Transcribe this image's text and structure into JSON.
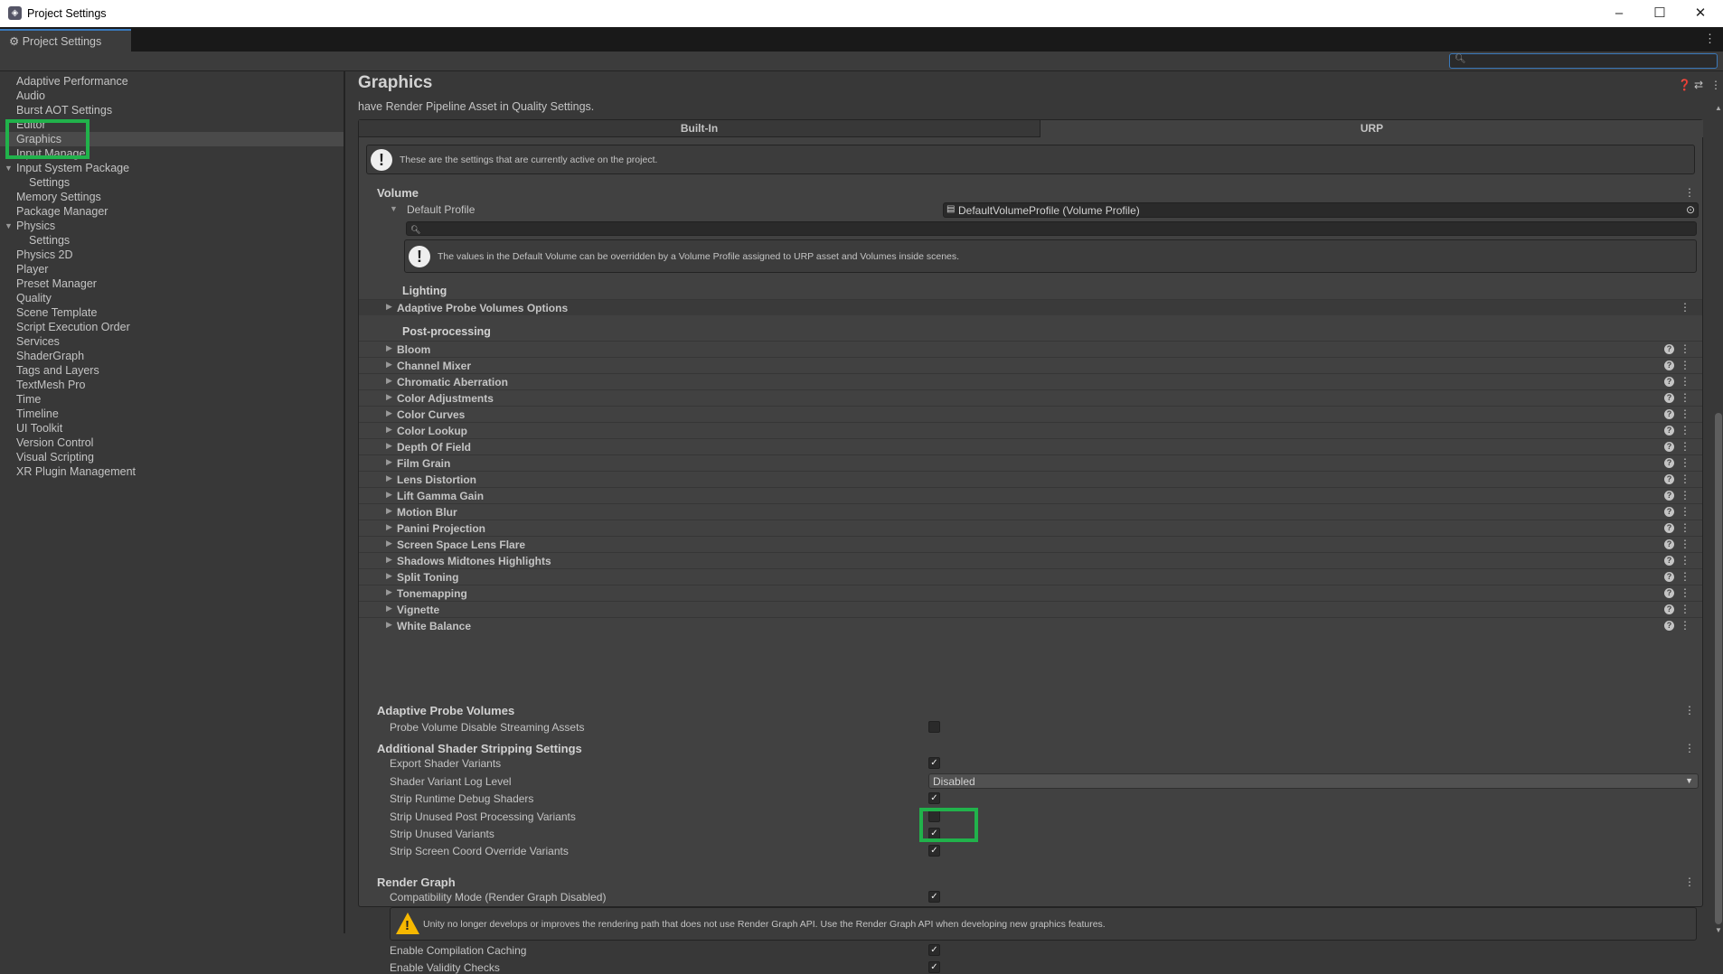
{
  "window": {
    "title": "Project Settings",
    "controls": [
      "minimize",
      "maximize",
      "close"
    ]
  },
  "tab": {
    "label": "Project Settings"
  },
  "search": {
    "placeholder": "",
    "value": ""
  },
  "sidebar": {
    "items": [
      {
        "label": "Adaptive Performance"
      },
      {
        "label": "Audio"
      },
      {
        "label": "Burst AOT Settings"
      },
      {
        "label": "Editor"
      },
      {
        "label": "Graphics",
        "selected": true
      },
      {
        "label": "Input Manage"
      },
      {
        "label": "Input System Package",
        "expanded": true
      },
      {
        "label": "Settings",
        "child": true
      },
      {
        "label": "Memory Settings"
      },
      {
        "label": "Package Manager"
      },
      {
        "label": "Physics",
        "expanded": true
      },
      {
        "label": "Settings",
        "child": true
      },
      {
        "label": "Physics 2D"
      },
      {
        "label": "Player"
      },
      {
        "label": "Preset Manager"
      },
      {
        "label": "Quality"
      },
      {
        "label": "Scene Template"
      },
      {
        "label": "Script Execution Order"
      },
      {
        "label": "Services"
      },
      {
        "label": "ShaderGraph"
      },
      {
        "label": "Tags and Layers"
      },
      {
        "label": "TextMesh Pro"
      },
      {
        "label": "Time"
      },
      {
        "label": "Timeline"
      },
      {
        "label": "UI Toolkit"
      },
      {
        "label": "Version Control"
      },
      {
        "label": "Visual Scripting"
      },
      {
        "label": "XR Plugin Management"
      }
    ]
  },
  "main": {
    "title": "Graphics",
    "subtitle": "have Render Pipeline Asset in Quality Settings.",
    "tabs": [
      {
        "label": "Built-In",
        "selected": false
      },
      {
        "label": "URP",
        "selected": true
      }
    ],
    "info": "These are the settings that are currently active on the project.",
    "volume": {
      "header": "Volume",
      "default_profile_label": "Default Profile",
      "default_profile_value": "DefaultVolumeProfile (Volume Profile)",
      "info": "The values in the Default Volume can be overridden by a Volume Profile assigned to URP asset and Volumes inside scenes.",
      "lighting_header": "Lighting",
      "lighting_items": [
        "Adaptive Probe Volumes Options"
      ],
      "post_header": "Post-processing",
      "post_items": [
        "Bloom",
        "Channel Mixer",
        "Chromatic Aberration",
        "Color Adjustments",
        "Color Curves",
        "Color Lookup",
        "Depth Of Field",
        "Film Grain",
        "Lens Distortion",
        "Lift Gamma Gain",
        "Motion Blur",
        "Panini Projection",
        "Screen Space Lens Flare",
        "Shadows Midtones Highlights",
        "Split Toning",
        "Tonemapping",
        "Vignette",
        "White Balance"
      ]
    },
    "apv": {
      "header": "Adaptive Probe Volumes",
      "rows": [
        {
          "label": "Probe Volume Disable Streaming Assets",
          "checked": false
        }
      ]
    },
    "stripping": {
      "header": "Additional Shader Stripping Settings",
      "rows": [
        {
          "label": "Export Shader Variants",
          "checked": true
        },
        {
          "label": "Shader Variant Log Level",
          "value": "Disabled"
        },
        {
          "label": "Strip Runtime Debug Shaders",
          "checked": true
        },
        {
          "label": "Strip Unused Post Processing Variants",
          "checked": false
        },
        {
          "label": "Strip Unused Variants",
          "checked": true
        },
        {
          "label": "Strip Screen Coord Override Variants",
          "checked": true
        }
      ]
    },
    "render_graph": {
      "header": "Render Graph",
      "compat_label": "Compatibility Mode (Render Graph Disabled)",
      "compat_checked": true,
      "warning": "Unity no longer develops or improves the rendering path that does not use Render Graph API. Use the Render Graph API when developing new graphics features.",
      "rows": [
        {
          "label": "Enable Compilation Caching",
          "checked": true
        },
        {
          "label": "Enable Validity Checks",
          "checked": true
        }
      ]
    }
  },
  "colors": {
    "highlight": "#21b24b",
    "accent": "#3a79bb",
    "warning": "#f6b800"
  }
}
